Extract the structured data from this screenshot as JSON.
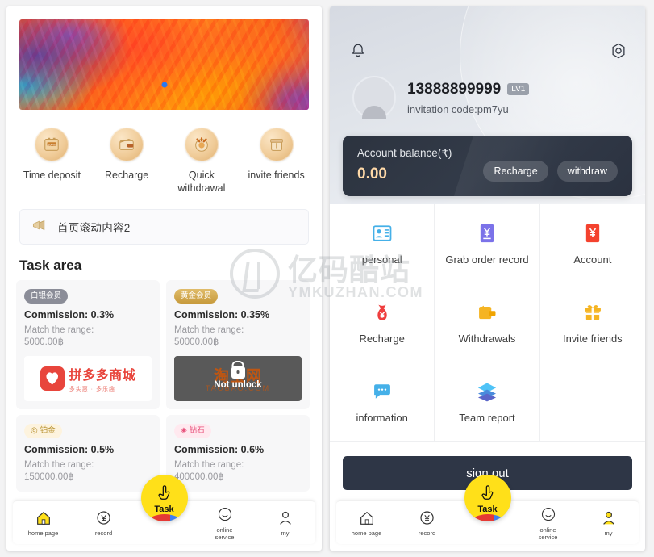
{
  "left_phone": {
    "banner": {
      "name": "promo-banner",
      "marker_color": "#2978f0"
    },
    "quick_actions": [
      {
        "label": "Time deposit",
        "icon": "safe-box-icon"
      },
      {
        "label": "Recharge",
        "icon": "wallet-icon"
      },
      {
        "label": "Quick\nwithdrawal",
        "icon": "coin-clock-icon"
      },
      {
        "label": "invite friends",
        "icon": "gift-bag-icon"
      }
    ],
    "notice": {
      "icon": "megaphone-icon",
      "text": "首页滚动内容2"
    },
    "task_area_title": "Task area",
    "tasks": [
      {
        "tier_label": "白银会员",
        "tier_style": "silver",
        "tier_icon": "",
        "commission": "Commission: 0.3%",
        "match_label": "Match the range:",
        "match_value": "5000.00฿",
        "shop": "pinduoduo",
        "shop_name": "拼多多商城",
        "shop_sub": "多实惠 · 多乐趣",
        "locked": false,
        "lock_text": ""
      },
      {
        "tier_label": "黄金会员",
        "tier_style": "gold",
        "tier_icon": "",
        "commission": "Commission: 0.35%",
        "match_label": "Match the range:",
        "match_value": "50000.00฿",
        "shop": "taobao",
        "shop_name": "淘宝网",
        "shop_sub": "TAOBAO.COM",
        "locked": true,
        "lock_text": "Not unlock"
      },
      {
        "tier_label": "铂金",
        "tier_style": "plat",
        "tier_icon": "◎",
        "commission": "Commission: 0.5%",
        "match_label": "Match the range:",
        "match_value": "150000.00฿",
        "shop": "none",
        "shop_name": "",
        "shop_sub": "",
        "locked": false,
        "lock_text": ""
      },
      {
        "tier_label": "钻石",
        "tier_style": "dia",
        "tier_icon": "◈",
        "commission": "Commission: 0.6%",
        "match_label": "Match the range:",
        "match_value": "400000.00฿",
        "shop": "none",
        "shop_name": "",
        "shop_sub": "",
        "locked": false,
        "lock_text": ""
      }
    ],
    "tabbar": {
      "items": [
        {
          "label": "home page",
          "icon": "home-icon",
          "active": true
        },
        {
          "label": "record",
          "icon": "yen-record-icon",
          "active": false
        },
        {
          "label": "online\nservice",
          "icon": "smiley-service-icon",
          "active": false
        },
        {
          "label": "my",
          "icon": "person-icon",
          "active": false
        }
      ],
      "fab": {
        "label": "Task",
        "icon": "tap-hand-icon",
        "color": "#ffe019"
      }
    }
  },
  "right_phone": {
    "header": {
      "bell_icon": "bell-icon",
      "settings_icon": "gear-icon",
      "avatar_icon": "avatar-placeholder",
      "username": "13888899999",
      "level_badge": "LV1",
      "invitation": "invitation code:pm7yu"
    },
    "balance": {
      "label": "Account balance(₹)",
      "value": "0.00",
      "recharge_label": "Recharge",
      "withdraw_label": "withdraw",
      "value_color": "#ffd9a8"
    },
    "menu": [
      {
        "label": "personal",
        "icon": "id-card-icon",
        "color": "#45b0e8"
      },
      {
        "label": "Grab order record",
        "icon": "yen-document-icon",
        "color": "#7b72e9"
      },
      {
        "label": "Account",
        "icon": "yen-book-icon",
        "color": "#f4422e"
      },
      {
        "label": "Recharge",
        "icon": "money-bag-icon",
        "color": "#ef3e3e"
      },
      {
        "label": "Withdrawals",
        "icon": "wallet-icon",
        "color": "#f5b422"
      },
      {
        "label": "Invite friends",
        "icon": "gift-icon",
        "color": "#f5b422"
      },
      {
        "label": "information",
        "icon": "chat-bubble-icon",
        "color": "#45b0e8"
      },
      {
        "label": "Team report",
        "icon": "layers-icon",
        "color": "#3fa9e8"
      }
    ],
    "sign_out_label": "sign out",
    "tabbar": {
      "items": [
        {
          "label": "home page",
          "icon": "home-icon",
          "active": false
        },
        {
          "label": "record",
          "icon": "yen-record-icon",
          "active": false
        },
        {
          "label": "online\nservice",
          "icon": "smiley-service-icon",
          "active": false
        },
        {
          "label": "my",
          "icon": "person-icon",
          "active": true
        }
      ],
      "fab": {
        "label": "Task",
        "icon": "tap-hand-icon",
        "color": "#ffe019"
      }
    }
  },
  "watermark": {
    "cn": "亿码酷站",
    "en": "YMKUZHAN.COM"
  }
}
